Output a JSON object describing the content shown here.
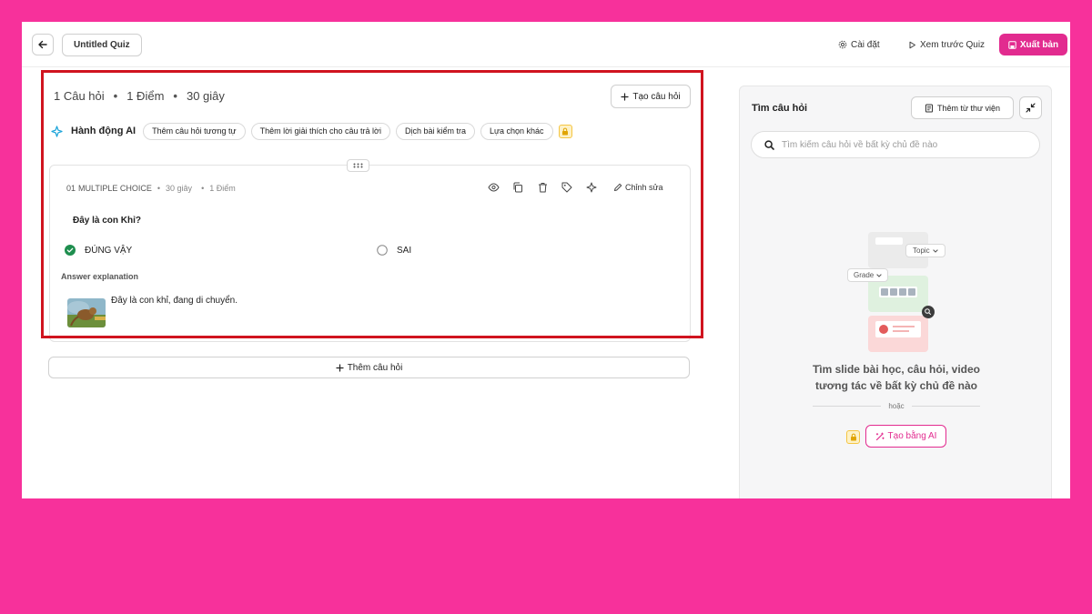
{
  "header": {
    "quiz_title": "Untitled Quiz",
    "settings_label": "Cài đặt",
    "preview_label": "Xem trước Quiz",
    "publish_label": "Xuất bản"
  },
  "editor": {
    "stats": {
      "questions": "1 Câu hỏi",
      "points": "1 Điểm",
      "time": "30 giây"
    },
    "create_question_label": "Tạo câu hỏi",
    "ai_actions": {
      "label": "Hành động AI",
      "chips": [
        "Thêm câu hỏi tương tự",
        "Thêm lời giải thích cho câu trả lời",
        "Dịch bài kiểm tra",
        "Lựa chọn khác"
      ]
    },
    "question": {
      "number": "01",
      "type": "MULTIPLE CHOICE",
      "time": "30 giây",
      "points": "1 Điểm",
      "edit_label": "Chỉnh sửa",
      "text": "Đây là con Khỉ?",
      "options": [
        {
          "label": "ĐÚNG VẬY",
          "correct": true
        },
        {
          "label": "SAI",
          "correct": false
        }
      ],
      "explanation_label": "Answer explanation",
      "explanation_text": "Đây là con khỉ, đang di chuyển."
    },
    "add_question_label": "Thêm câu hỏi"
  },
  "panel": {
    "title": "Tìm câu hỏi",
    "library_label": "Thêm từ thư viện",
    "search_placeholder": "Tìm kiếm câu hỏi về bất kỳ chủ đề nào",
    "illustration": {
      "topic_label": "Topic",
      "grade_label": "Grade"
    },
    "empty_line1": "Tìm slide bài học, câu hỏi, video",
    "empty_line2": "tương tác về bất kỳ chủ đề nào",
    "or_label": "hoặc",
    "ai_create_label": "Tạo bằng AI"
  },
  "colors": {
    "background": "#f7319b",
    "accent": "#e22b8f",
    "highlight": "#d0141f",
    "correct": "#1e8e4e"
  }
}
